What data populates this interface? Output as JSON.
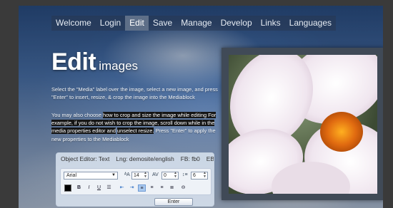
{
  "nav": {
    "items": [
      "Welcome",
      "Login",
      "Edit",
      "Save",
      "Manage",
      "Develop",
      "Links",
      "Languages"
    ],
    "active": "Edit"
  },
  "headline": {
    "big": "Edit",
    "small": "images"
  },
  "paragraphs": {
    "p1": "Select the \"Media\" label over the image, select a new image, and press \"Enter\" to insert, resize, & crop the image into the Mediablock",
    "p2_lead": "You may also choose ",
    "p2_hl": "how to crop and size the image while editing For example, if you do not wish to crop the image, scroll down while in the media properties editor and",
    "p2_mid": " ",
    "p2_hl2": "unselect resize.",
    "p2_tail": " Press \"Enter\" to apply the new properties to the Mediablock"
  },
  "editor": {
    "status": [
      "Object Editor: Text",
      "Lng: demosite/english",
      "FB: fb0",
      "EB: root"
    ],
    "font": "Arial",
    "font_size": "14",
    "letter_spacing": "0",
    "line_height": "6",
    "enter_label": "Enter",
    "text_color": "#000000"
  },
  "colors": {
    "nav_active": "#5e6f88",
    "highlight": "#151515"
  },
  "icons": [
    "text-size-icon",
    "letter-spacing-icon",
    "line-height-icon",
    "bold-icon",
    "italic-icon",
    "underline-icon",
    "list-icon",
    "indent-left-icon",
    "indent-right-icon",
    "align-left-icon",
    "align-center-icon",
    "align-right-icon",
    "justify-icon",
    "link-icon"
  ]
}
